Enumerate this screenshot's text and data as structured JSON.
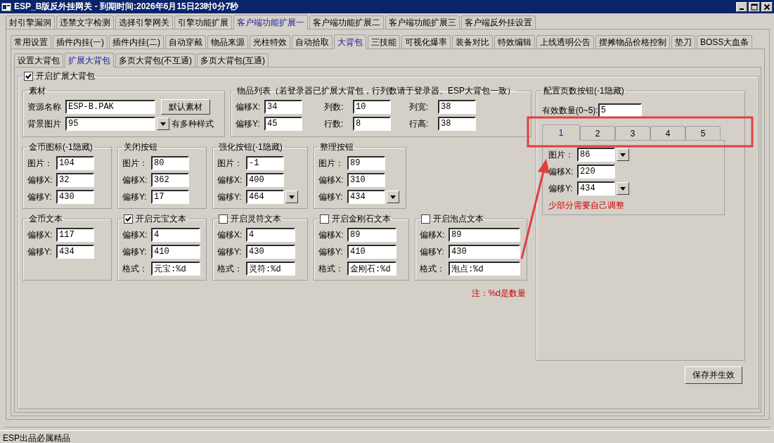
{
  "window": {
    "title": "ESP_B版反外挂网关 - 到期时间:2026年6月15日23时0分7秒"
  },
  "tabs_main": [
    {
      "label": "封引擎漏洞",
      "selected": false
    },
    {
      "label": "违禁文字检测",
      "selected": false
    },
    {
      "label": "选择引擎网关",
      "selected": false
    },
    {
      "label": "引擎功能扩展",
      "selected": false
    },
    {
      "label": "客户端功能扩展一",
      "selected": true
    },
    {
      "label": "客户端功能扩展二",
      "selected": false
    },
    {
      "label": "客户端功能扩展三",
      "selected": false
    },
    {
      "label": "客户端反外挂设置",
      "selected": false
    }
  ],
  "tabs_sub": [
    {
      "label": "常用设置",
      "selected": false
    },
    {
      "label": "插件内挂(一)",
      "selected": false
    },
    {
      "label": "插件内挂(二)",
      "selected": false
    },
    {
      "label": "自动穿戴",
      "selected": false
    },
    {
      "label": "物品来源",
      "selected": false
    },
    {
      "label": "光柱特效",
      "selected": false
    },
    {
      "label": "自动拾取",
      "selected": false
    },
    {
      "label": "大背包",
      "selected": true
    },
    {
      "label": "三技能",
      "selected": false
    },
    {
      "label": "可视化爆率",
      "selected": false
    },
    {
      "label": "装备对比",
      "selected": false
    },
    {
      "label": "特效编辑",
      "selected": false
    },
    {
      "label": "上线透明公告",
      "selected": false
    },
    {
      "label": "摆摊物品价格控制",
      "selected": false
    },
    {
      "label": "垫刀",
      "selected": false
    },
    {
      "label": "BOSS大血条",
      "selected": false
    }
  ],
  "tabs_bag": [
    {
      "label": "设置大背包",
      "selected": false
    },
    {
      "label": "扩展大背包",
      "selected": true
    },
    {
      "label": "多页大背包(不互通)",
      "selected": false
    },
    {
      "label": "多页大背包(互通)",
      "selected": false
    }
  ],
  "enable": {
    "label": "开启扩展大背包",
    "checked": true
  },
  "material": {
    "title": "素材",
    "name_label": "资源名称",
    "name_value": "ESP-B.PAK",
    "default_button": "默认素材",
    "bg_label": "背景图片",
    "bg_value": "95",
    "bg_hint": "有多种样式"
  },
  "item_list": {
    "title": "物品列表（若登录器已扩展大背包，行列数请于登录器、ESP大背包一致）",
    "fields": [
      {
        "label": "偏移X:",
        "value": "34"
      },
      {
        "label": "列数:",
        "value": "10"
      },
      {
        "label": "列宽:",
        "value": "38"
      },
      {
        "label": "偏移Y:",
        "value": "45"
      },
      {
        "label": "行数:",
        "value": "8"
      },
      {
        "label": "行高:",
        "value": "38"
      }
    ]
  },
  "button_groups": [
    {
      "title": "金币图标(-1隐藏)",
      "fields": [
        {
          "label": "图片：",
          "value": "104"
        },
        {
          "label": "偏移X:",
          "value": "32"
        },
        {
          "label": "偏移Y:",
          "value": "430"
        }
      ]
    },
    {
      "title": "关闭按钮",
      "fields": [
        {
          "label": "图片：",
          "value": "80"
        },
        {
          "label": "偏移X:",
          "value": "362"
        },
        {
          "label": "偏移Y:",
          "value": "17"
        }
      ]
    },
    {
      "title": "强化按钮(-1隐藏)",
      "fields": [
        {
          "label": "图片：",
          "value": "-1"
        },
        {
          "label": "偏移X:",
          "value": "400"
        },
        {
          "label": "偏移Y:",
          "value": "464",
          "dropdown": true
        }
      ]
    },
    {
      "title": "整理按钮",
      "fields": [
        {
          "label": "图片：",
          "value": "89"
        },
        {
          "label": "偏移X:",
          "value": "310"
        },
        {
          "label": "偏移Y:",
          "value": "434",
          "dropdown": true
        }
      ]
    }
  ],
  "text_groups": [
    {
      "kind": "plain",
      "title": "金币文本",
      "fields": [
        {
          "label": "偏移X:",
          "value": "117"
        },
        {
          "label": "偏移Y:",
          "value": "434"
        }
      ]
    },
    {
      "kind": "checkbox",
      "title": "开启元宝文本",
      "checked": true,
      "fields": [
        {
          "label": "偏移X:",
          "value": "4"
        },
        {
          "label": "偏移Y:",
          "value": "410"
        },
        {
          "label": "格式：",
          "value": "元宝:%d"
        }
      ]
    },
    {
      "kind": "checkbox",
      "title": "开启灵符文本",
      "checked": false,
      "fields": [
        {
          "label": "偏移X:",
          "value": "4"
        },
        {
          "label": "偏移Y:",
          "value": "430"
        },
        {
          "label": "格式：",
          "value": "灵符:%d"
        }
      ]
    },
    {
      "kind": "checkbox",
      "title": "开启金刚石文本",
      "checked": false,
      "fields": [
        {
          "label": "偏移X:",
          "value": "89"
        },
        {
          "label": "偏移Y:",
          "value": "410"
        },
        {
          "label": "格式：",
          "value": "金刚石:%d"
        }
      ]
    },
    {
      "kind": "checkbox",
      "title": "开启泡点文本",
      "checked": false,
      "fields": [
        {
          "label": "偏移X:",
          "value": "89"
        },
        {
          "label": "偏移Y:",
          "value": "430"
        },
        {
          "label": "格式：",
          "value": "泡点:%d"
        }
      ]
    }
  ],
  "note": "注：%d是数量",
  "page_buttons": {
    "title": "配置页数按钮(-1隐藏)",
    "count_label": "有效数量(0~5):",
    "count_value": "5",
    "tabs": [
      {
        "label": "1",
        "selected": true
      },
      {
        "label": "2",
        "selected": false
      },
      {
        "label": "3",
        "selected": false
      },
      {
        "label": "4",
        "selected": false
      },
      {
        "label": "5",
        "selected": false
      }
    ],
    "fields": [
      {
        "label": "图片：",
        "value": "86",
        "dropdown": true
      },
      {
        "label": "偏移X:",
        "value": "220"
      },
      {
        "label": "偏移Y:",
        "value": "434",
        "dropdown": true
      }
    ],
    "annotation": "少部分需要自己调整"
  },
  "save_button": "保存并生效",
  "status_bar": "ESP出品必属精品"
}
